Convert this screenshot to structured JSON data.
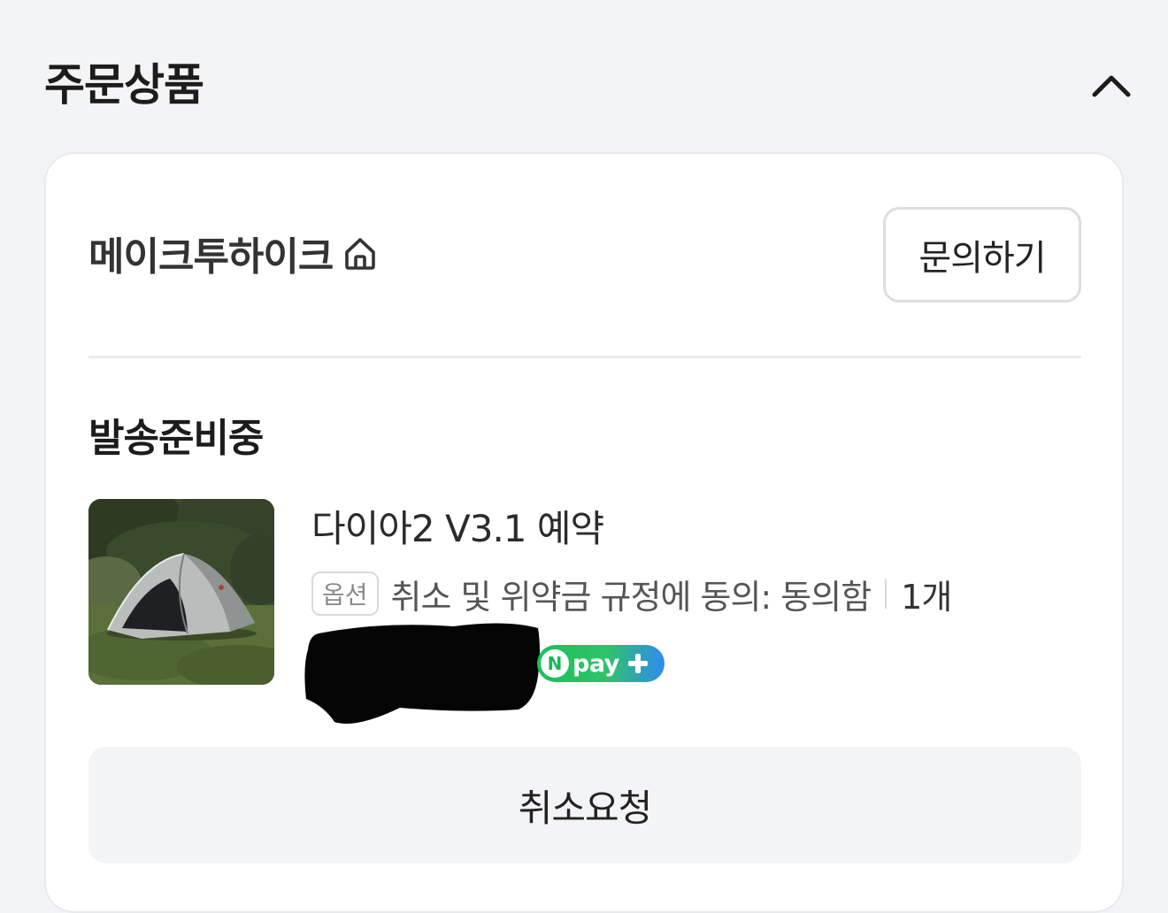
{
  "header": {
    "title": "주문상품",
    "toggle_icon": "chevron-up-icon"
  },
  "store": {
    "name": "메이크투하이크",
    "home_icon": "home-icon",
    "inquiry_label": "문의하기"
  },
  "order": {
    "status": "발송준비중",
    "product": {
      "thumbnail_icon": "tent-photo",
      "name": "다이아2 V3.1 예약",
      "option_badge": "옵션",
      "option_text": "취소 및 위약금 규정에 동의: 동의함",
      "quantity": "1개",
      "price_redacted": true,
      "payment_badge": {
        "n_letter": "N",
        "text": "pay",
        "plus_icon": "plus-icon"
      }
    },
    "cancel_label": "취소요청"
  },
  "colors": {
    "page_bg": "#f3f4f6",
    "card_bg": "#ffffff",
    "npay_green": "#19c15a",
    "npay_blue": "#2f8bf0"
  }
}
